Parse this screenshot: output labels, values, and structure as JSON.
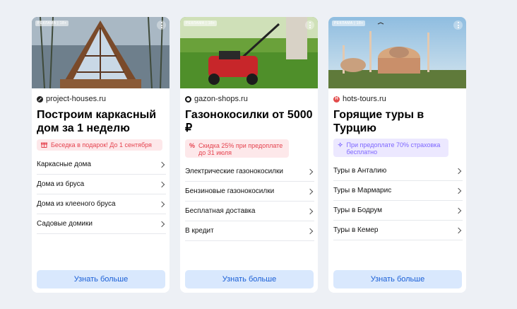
{
  "cards": [
    {
      "ad_label": "РЕКЛАМА | 18+",
      "domain": "project-houses.ru",
      "favicon": "leaf-icon",
      "title": "Построим каркасный дом за 1 неделю",
      "promo": "Беседка в подарок! До 1 сентября",
      "promo_icon": "gift-icon",
      "links": [
        "Каркасные дома",
        "Дома из бруса",
        "Дома из клееного бруса",
        "Садовые домики"
      ],
      "button": "Узнать больше"
    },
    {
      "ad_label": "РЕКЛАМА | 18+",
      "domain": "gazon-shops.ru",
      "favicon": "ring-icon",
      "title": "Газонокосилки от 5000 ₽",
      "promo_icon_text": "%",
      "promo": "Скидка 25% при предоплате до 31 июля",
      "links": [
        "Электрические газонокосилки",
        "Бензиновые газонокосилки",
        "Бесплатная доставка",
        "В кредит"
      ],
      "button": "Узнать больше"
    },
    {
      "ad_label": "РЕКЛАМА | 18+",
      "domain": "hots-tours.ru",
      "favicon": "h-logo-icon",
      "favicon_letter": "H",
      "title": "Горящие туры в Турцию",
      "promo_icon_text": "✧",
      "promo": "При предоплате 70% страховка бесплатно",
      "links": [
        "Туры в Анталию",
        "Туры в Мармарис",
        "Туры в Бодрум",
        "Туры в Кемер"
      ],
      "button": "Узнать больше"
    }
  ]
}
